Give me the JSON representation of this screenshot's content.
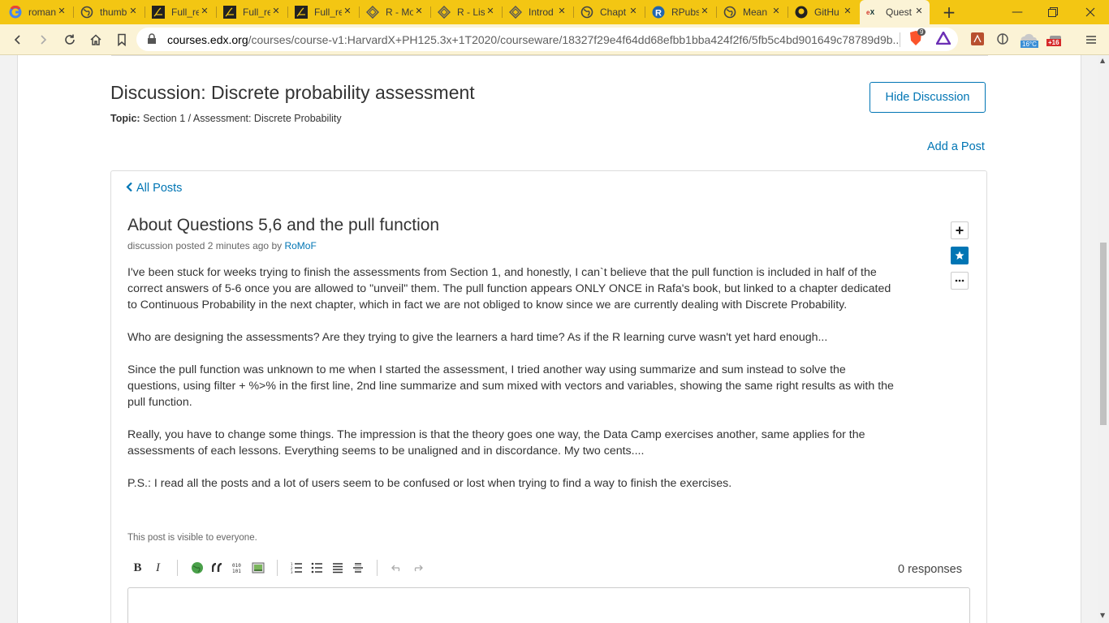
{
  "browser": {
    "tabs": [
      {
        "title": "roman",
        "icon": "google-icon",
        "active": false
      },
      {
        "title": "thumb",
        "icon": "globe-icon",
        "active": false
      },
      {
        "title": "Full_re",
        "icon": "pdf-signature-icon",
        "active": false
      },
      {
        "title": "Full_re",
        "icon": "pdf-signature-icon",
        "active": false
      },
      {
        "title": "Full_re",
        "icon": "pdf-signature-icon",
        "active": false
      },
      {
        "title": "R - Mo",
        "icon": "diamond-logo-icon",
        "active": false
      },
      {
        "title": "R - Lis",
        "icon": "diamond-logo-icon",
        "active": false
      },
      {
        "title": "Introd",
        "icon": "diamond-logo-icon",
        "active": false
      },
      {
        "title": "Chapt",
        "icon": "globe-icon",
        "active": false
      },
      {
        "title": "RPubs",
        "icon": "r-logo-icon",
        "active": false
      },
      {
        "title": "Mean",
        "icon": "globe-icon",
        "active": false
      },
      {
        "title": "GitHu",
        "icon": "github-icon",
        "active": false
      },
      {
        "title": "Quest",
        "icon": "edx-icon",
        "active": true
      }
    ],
    "url_domain": "courses.edx.org",
    "url_path": "/courses/course-v1:HarvardX+PH125.3x+1T2020/courseware/18327f29e4f64dd68efbb1bba424f2f6/5fb5c4bd901649c78789d9b...",
    "brave_badge": "9",
    "weather": "16°C",
    "ext_badge": "+16",
    "accent": "#f3c613"
  },
  "discussion": {
    "title": "Discussion: Discrete probability assessment",
    "topic_label": "Topic:",
    "topic_value": "Section 1 / Assessment: Discrete Probability",
    "hide_button": "Hide Discussion",
    "add_post": "Add a Post",
    "all_posts": "All Posts"
  },
  "post": {
    "title": "About Questions 5,6 and the pull function",
    "meta_prefix": "discussion posted 2 minutes ago by",
    "author": "RoMoF",
    "paragraphs": [
      "I've been stuck for weeks trying to finish the assessments from Section 1, and honestly, I can`t believe that the pull function is included in half of the correct answers of 5-6 once you are allowed to \"unveil\" them. The pull function appears ONLY ONCE in Rafa's book, but linked to a chapter dedicated to Continuous Probability in the next chapter, which in fact we are not obliged to know since we are currently dealing with Discrete Probability.",
      "Who are designing the assessments? Are they trying to give the learners a hard time? As if the R learning curve wasn't yet hard enough...",
      "Since the pull function was unknown to me when I started the assessment, I tried another way using summarize and sum instead to solve the questions, using filter + %>% in the first line, 2nd line summarize and sum mixed with vectors and variables, showing the same right results as with the pull function.",
      "Really, you have to change some things. The impression is that the theory goes one way, the Data Camp exercises another, same applies for the assessments of each lessons. Everything seems to be unaligned and in discordance. My two cents....",
      "P.S.: I read all the posts and a lot of users seem to be confused or lost when trying to find a way to finish the exercises."
    ],
    "visibility": "This post is visible to everyone.",
    "responses": "0 responses",
    "link_color": "#0075b4"
  }
}
